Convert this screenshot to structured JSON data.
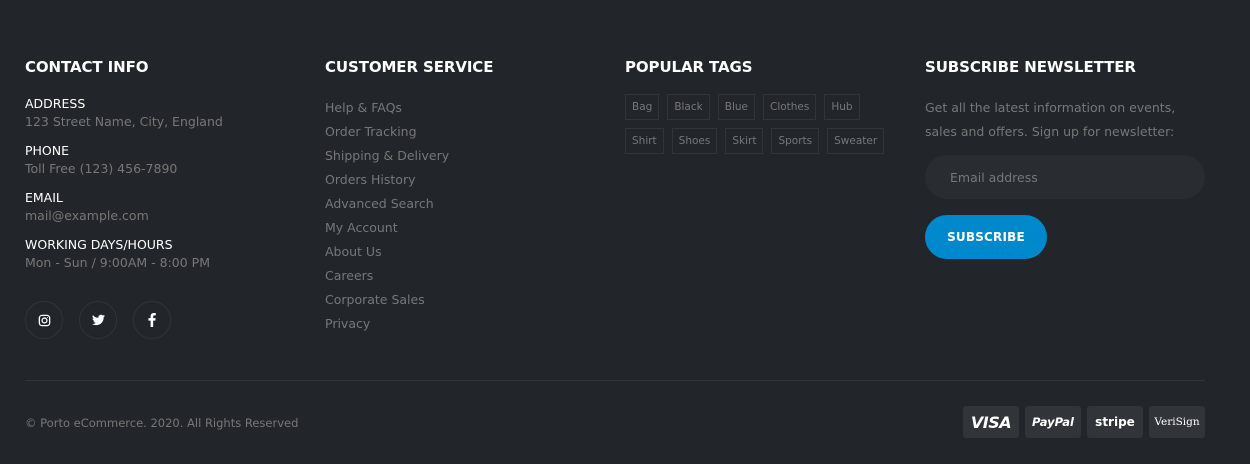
{
  "contact": {
    "title": "CONTACT INFO",
    "items": [
      {
        "label": "ADDRESS",
        "value": "123 Street Name, City, England"
      },
      {
        "label": "PHONE",
        "value": "Toll Free (123) 456-7890"
      },
      {
        "label": "EMAIL",
        "value": "mail@example.com"
      },
      {
        "label": "WORKING DAYS/HOURS",
        "value": "Mon - Sun / 9:00AM - 8:00 PM"
      }
    ],
    "social": [
      "instagram-icon",
      "twitter-icon",
      "facebook-icon"
    ]
  },
  "customer_service": {
    "title": "CUSTOMER SERVICE",
    "links": [
      "Help & FAQs",
      "Order Tracking",
      "Shipping & Delivery",
      "Orders History",
      "Advanced Search",
      "My Account",
      "About Us",
      "Careers",
      "Corporate Sales",
      "Privacy"
    ]
  },
  "tags": {
    "title": "POPULAR TAGS",
    "items": [
      "Bag",
      "Black",
      "Blue",
      "Clothes",
      "Hub",
      "Shirt",
      "Shoes",
      "Skirt",
      "Sports",
      "Sweater"
    ]
  },
  "newsletter": {
    "title": "SUBSCRIBE NEWSLETTER",
    "text": "Get all the latest information on events, sales and offers. Sign up for newsletter:",
    "placeholder": "Email address",
    "button": "SUBSCRIBE"
  },
  "bottom": {
    "copyright": "© Porto eCommerce. 2020. All Rights Reserved",
    "payments": [
      "VISA",
      "PayPal",
      "stripe",
      "VeriSign"
    ]
  },
  "colors": {
    "background": "#222529",
    "accent": "#0088cc",
    "text": "#777777",
    "heading": "#ffffff"
  }
}
